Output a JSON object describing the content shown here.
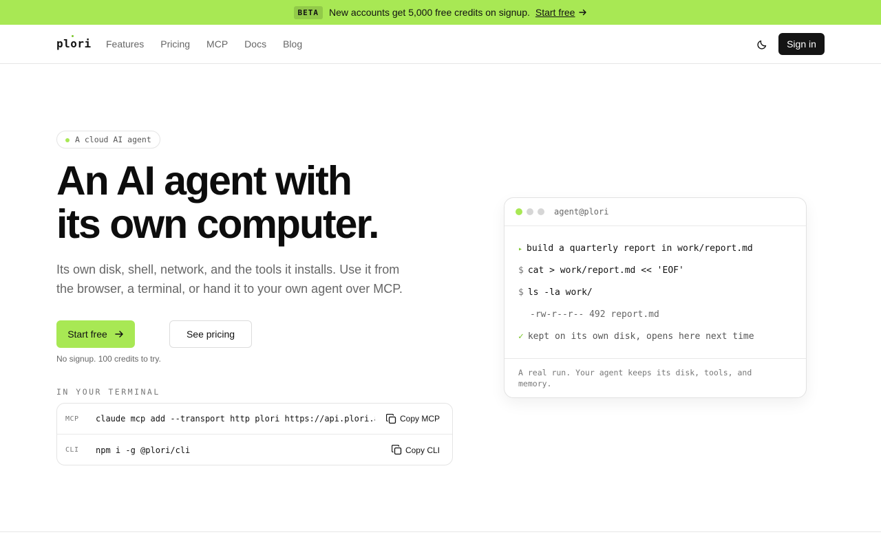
{
  "banner": {
    "badge": "BETA",
    "message": "New accounts get 5,000 free credits on signup.",
    "link": "Start free"
  },
  "nav": {
    "logo": "plori",
    "links": [
      "Features",
      "Pricing",
      "MCP",
      "Docs",
      "Blog"
    ],
    "signin": "Sign in"
  },
  "hero": {
    "pill": "A cloud AI agent",
    "headline_line1": "An AI agent with",
    "headline_line2": "its own computer.",
    "subtext": "Its own disk, shell, network, and the tools it installs. Use it from the browser, a terminal, or hand it to your own agent over MCP.",
    "start_button": "Start free",
    "pricing_button": "See pricing",
    "note": "No signup. 100 credits to try."
  },
  "terminal_install": {
    "label": "IN YOUR TERMINAL",
    "rows": [
      {
        "tag": "MCP",
        "command": "claude mcp add --transport http plori https://api.plori.ai/mcp",
        "copy": "Copy MCP"
      },
      {
        "tag": "CLI",
        "command": "npm i -g @plori/cli",
        "copy": "Copy CLI"
      }
    ]
  },
  "card": {
    "title": "agent@plori",
    "dot_colors": [
      "#a8e854",
      "#d6d6d6",
      "#d6d6d6"
    ],
    "lines": [
      {
        "prefix": "▸",
        "text": "build a quarterly report in work/report.md"
      },
      {
        "prefix": "$",
        "text": "cat > work/report.md << 'EOF'"
      },
      {
        "prefix": "$",
        "text": "ls -la work/"
      },
      {
        "prefix": "",
        "text": "-rw-r--r-- 492 report.md"
      },
      {
        "prefix": "✓",
        "text": "kept on its own disk, opens here next time"
      }
    ],
    "footer": "A real run. Your agent keeps its disk, tools, and memory."
  },
  "colors": {
    "accent": "#a8e854",
    "dark": "#141414"
  }
}
